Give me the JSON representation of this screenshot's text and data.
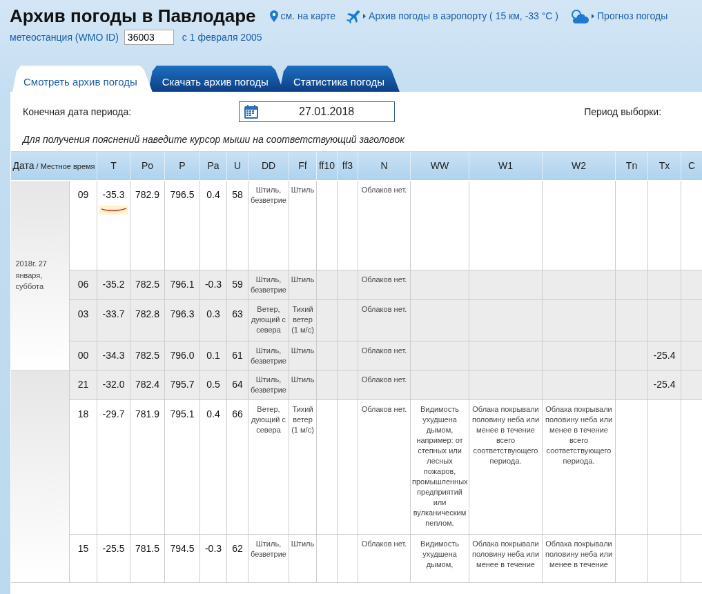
{
  "header": {
    "title": "Архив погоды в Павлодаре",
    "links": [
      {
        "kind": "pin",
        "label": "см. на карте"
      },
      {
        "kind": "plane",
        "label": "Архив погоды в аэропорту ( 15 км, -33 °C )"
      },
      {
        "kind": "cloud",
        "label": "Прогноз погоды"
      }
    ],
    "station": {
      "label": "метеостанция (WMO ID)",
      "value": "36003",
      "since": "с 1 февраля 2005"
    }
  },
  "tabs": [
    {
      "label": "Смотреть архив погоды",
      "selected": true
    },
    {
      "label": "Скачать архив погоды",
      "selected": false
    },
    {
      "label": "Статистика погоды",
      "selected": false
    }
  ],
  "period": {
    "end_label": "Конечная дата периода:",
    "end_value": "27.01.2018",
    "range_label": "Период выборки:"
  },
  "hint": "Для получения пояснений наведите курсор мыши на соответствующий заголовок",
  "table": {
    "date_heading": "Дата",
    "time_heading": "/ Местное время",
    "columns": [
      "T",
      "Po",
      "P",
      "Pa",
      "U",
      "DD",
      "Ff",
      "ff10",
      "ff3",
      "N",
      "WW",
      "W1",
      "W2",
      "Tn",
      "Tx",
      "С"
    ],
    "groups": [
      {
        "date": "2018г. 27 января, суббота",
        "rows": [
          {
            "time": "09",
            "t": "-35.3",
            "po": "782.9",
            "p": "796.5",
            "pa": "0.4",
            "u": "58",
            "dd": "Штиль, безветрие",
            "ff": "Штиль",
            "n": "Облаков нет.",
            "shaded": false,
            "t_marked": true
          },
          {
            "time": "06",
            "t": "-35.2",
            "po": "782.5",
            "p": "796.1",
            "pa": "-0.3",
            "u": "59",
            "dd": "Штиль, безветрие",
            "ff": "Штиль",
            "n": "Облаков нет.",
            "shaded": true,
            "t_marked": false
          },
          {
            "time": "03",
            "t": "-33.7",
            "po": "782.8",
            "p": "796.3",
            "pa": "0.3",
            "u": "63",
            "dd": "Ветер, дующий с севера",
            "ff": "Тихий ветер (1 м/с)",
            "n": "Облаков нет.",
            "shaded": true,
            "t_marked": false
          },
          {
            "time": "00",
            "t": "-34.3",
            "po": "782.5",
            "p": "796.0",
            "pa": "0.1",
            "u": "61",
            "dd": "Штиль, безветрие",
            "ff": "Штиль",
            "n": "Облаков нет.",
            "tx": "-25.4",
            "shaded": true,
            "t_marked": false
          }
        ]
      },
      {
        "rows": [
          {
            "time": "21",
            "t": "-32.0",
            "po": "782.4",
            "p": "795.7",
            "pa": "0.5",
            "u": "64",
            "dd": "Штиль, безветрие",
            "ff": "Штиль",
            "n": "Облаков нет.",
            "tx": "-25.4",
            "shaded": true,
            "t_marked": false
          },
          {
            "time": "18",
            "t": "-29.7",
            "po": "781.9",
            "p": "795.1",
            "pa": "0.4",
            "u": "66",
            "dd": "Ветер, дующий с севера",
            "ff": "Тихий ветер (1 м/с)",
            "n": "Облаков нет.",
            "ww": "Видимость ухудшена дымом, например: от степных или лесных пожаров, промышленных предприятий или вулканическим пеплом.",
            "w1": "Облака покрывали половину неба или менее в течение всего соответствующего периода.",
            "w2": "Облака покрывали половину неба или менее в течение всего соответствующего периода.",
            "shaded": false,
            "t_marked": false
          },
          {
            "time": "15",
            "t": "-25.5",
            "po": "781.5",
            "p": "794.5",
            "pa": "-0.3",
            "u": "62",
            "dd": "Штиль, безветрие",
            "ff": "Штиль",
            "n": "Облаков нет.",
            "ww": "Видимость ухудшена дымом,",
            "w1": "Облака покрывали половину неба или менее в течение",
            "w2": "Облака покрывали половину неба или менее в течение",
            "shaded": false,
            "t_marked": false
          }
        ]
      }
    ]
  }
}
